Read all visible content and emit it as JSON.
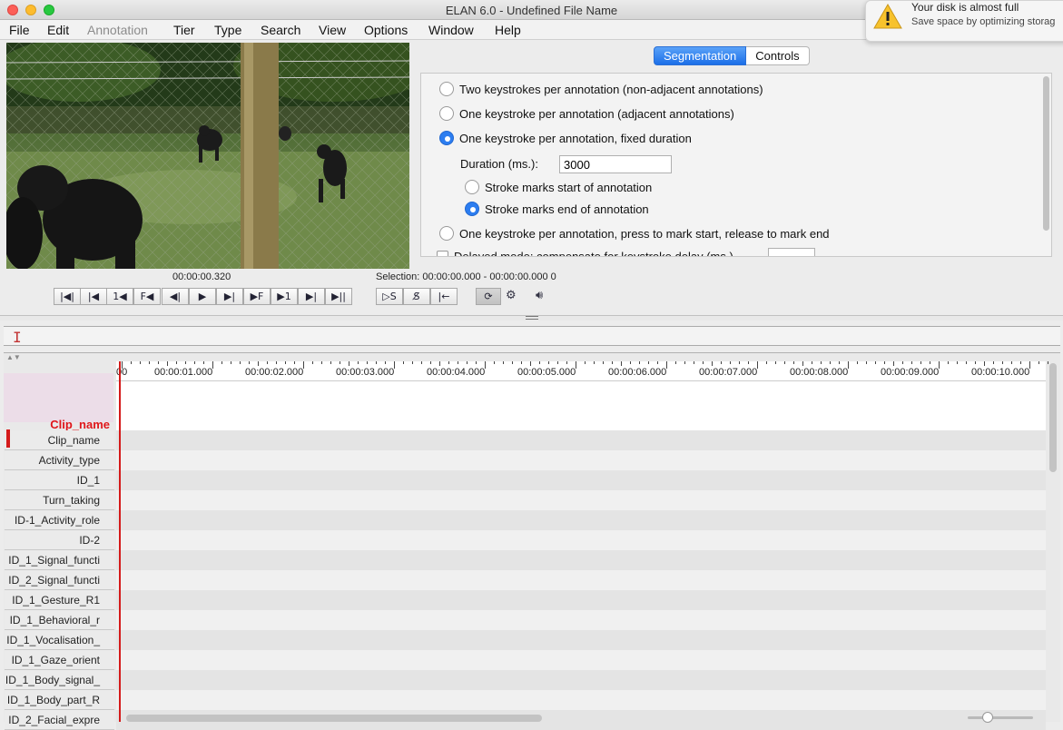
{
  "window": {
    "title": "ELAN 6.0 - Undefined File Name"
  },
  "menubar": {
    "items": [
      {
        "label": "File",
        "enabled": true
      },
      {
        "label": "Edit",
        "enabled": true
      },
      {
        "label": "Annotation",
        "enabled": false
      },
      {
        "label": "Tier",
        "enabled": true
      },
      {
        "label": "Type",
        "enabled": true
      },
      {
        "label": "Search",
        "enabled": true
      },
      {
        "label": "View",
        "enabled": true
      },
      {
        "label": "Options",
        "enabled": true
      },
      {
        "label": "Window",
        "enabled": true
      },
      {
        "label": "Help",
        "enabled": true
      }
    ]
  },
  "notification": {
    "icon": "warning-icon",
    "title": "Your disk is almost full",
    "body": "Save space by optimizing storag"
  },
  "tabs": [
    {
      "label": "Segmentation",
      "active": true
    },
    {
      "label": "Controls",
      "active": false
    }
  ],
  "segmentation": {
    "options": [
      {
        "label": "Two keystrokes per annotation (non-adjacent annotations)",
        "selected": false
      },
      {
        "label": "One keystroke per annotation (adjacent annotations)",
        "selected": false
      },
      {
        "label": "One keystroke per annotation, fixed duration",
        "selected": true
      },
      {
        "label": "One keystroke per annotation, press to mark start, release to mark end",
        "selected": false
      }
    ],
    "duration_label": "Duration (ms.):",
    "duration_value": "3000",
    "stroke_options": [
      {
        "label": "Stroke marks start of annotation",
        "selected": false
      },
      {
        "label": "Stroke marks end of annotation",
        "selected": true
      }
    ],
    "delayed_mode_label": "Delayed mode: compensate for keystroke delay (ms.)"
  },
  "media": {
    "current_time": "00:00:00.320",
    "selection": "Selection: 00:00:00.000 - 00:00:00.000  0"
  },
  "transport_buttons": [
    {
      "name": "go-to-begin-button",
      "glyph": "|◀|"
    },
    {
      "name": "previous-frame-step-button",
      "glyph": "|◀"
    },
    {
      "name": "one-pixel-back-button",
      "glyph": "1◀"
    },
    {
      "name": "second-back-button",
      "glyph": "F◀"
    },
    {
      "name": "previous-annotation-button",
      "glyph": "◀|"
    },
    {
      "name": "play-button",
      "glyph": "▶"
    },
    {
      "name": "next-annotation-button",
      "glyph": "▶|"
    },
    {
      "name": "second-forward-button",
      "glyph": "▶F"
    },
    {
      "name": "one-pixel-forward-button",
      "glyph": "▶1"
    },
    {
      "name": "next-frame-button",
      "glyph": "▶|"
    },
    {
      "name": "go-to-end-button",
      "glyph": "▶||"
    }
  ],
  "selection_buttons": [
    {
      "name": "play-selection-button",
      "glyph": "▷S"
    },
    {
      "name": "clear-selection-button",
      "glyph": "S̸"
    },
    {
      "name": "selection-begin-button",
      "glyph": "|←"
    }
  ],
  "loop_icons": [
    "loop-mode-icon",
    "settings-gear-icon",
    "volume-icon"
  ],
  "ruler": {
    "ticks": [
      "00:00:01.000",
      "00:00:02.000",
      "00:00:03.000",
      "00:00:04.000",
      "00:00:05.000",
      "00:00:06.000",
      "00:00:07.000",
      "00:00:08.000",
      "00:00:09.000",
      "00:00:10.000"
    ],
    "start_fragment": "00"
  },
  "active_tier": {
    "label": "Clip_name"
  },
  "tiers": [
    "Clip_name",
    "Activity_type",
    "ID_1",
    "Turn_taking",
    "ID-1_Activity_role",
    "ID-2",
    "ID_1_Signal_functi",
    "ID_2_Signal_functi",
    "ID_1_Gesture_R1",
    "ID_1_Behavioral_r",
    "ID_1_Vocalisation_",
    "ID_1_Gaze_orient",
    "ID_1_Body_signal_",
    "ID_1_Body_part_R",
    "ID_2_Facial_expre"
  ]
}
